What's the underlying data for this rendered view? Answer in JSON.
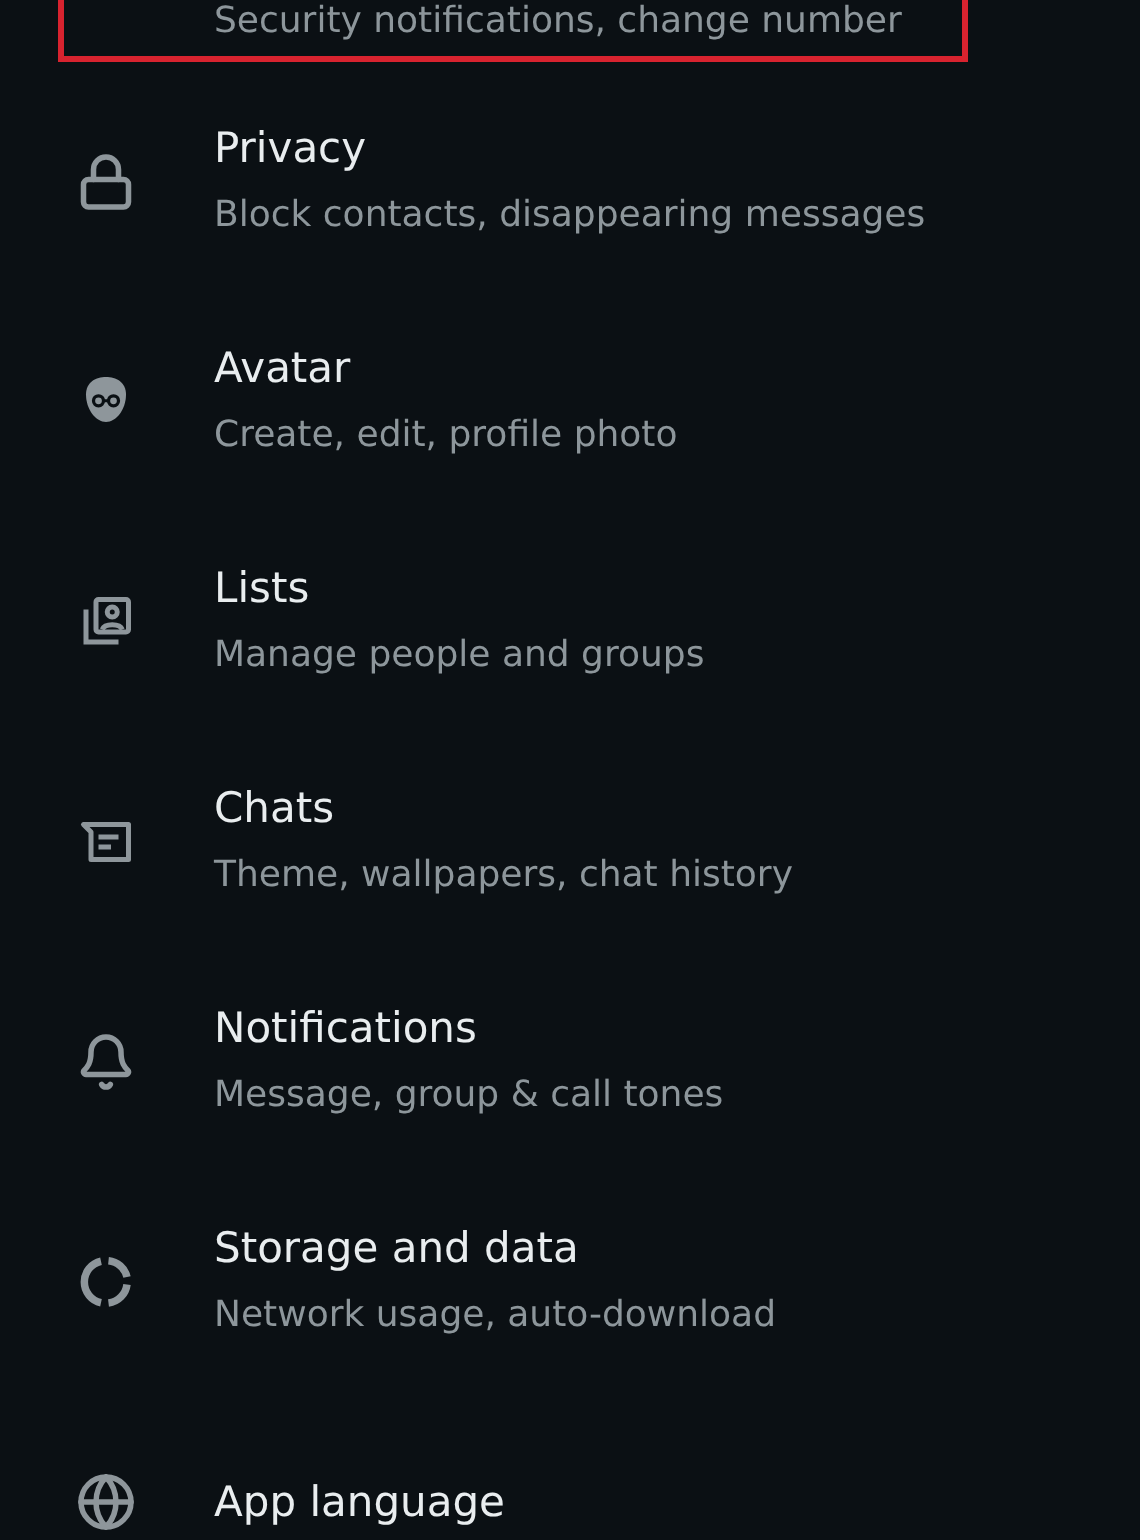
{
  "settings_items": [
    {
      "kind": "account",
      "subtitle": "Security notifications, change number",
      "highlighted": true
    },
    {
      "kind": "lock",
      "title": "Privacy",
      "subtitle": "Block contacts, disappearing messages",
      "highlighted": false
    },
    {
      "kind": "avatar",
      "title": "Avatar",
      "subtitle": "Create, edit, profile photo",
      "highlighted": false
    },
    {
      "kind": "lists",
      "title": "Lists",
      "subtitle": "Manage people and groups",
      "highlighted": false
    },
    {
      "kind": "chats",
      "title": "Chats",
      "subtitle": "Theme, wallpapers, chat history",
      "highlighted": false
    },
    {
      "kind": "bell",
      "title": "Notifications",
      "subtitle": "Message, group & call tones",
      "highlighted": false
    },
    {
      "kind": "storage",
      "title": "Storage and data",
      "subtitle": "Network usage, auto-download",
      "highlighted": false
    },
    {
      "kind": "globe",
      "title": "App language",
      "highlighted": false
    }
  ]
}
